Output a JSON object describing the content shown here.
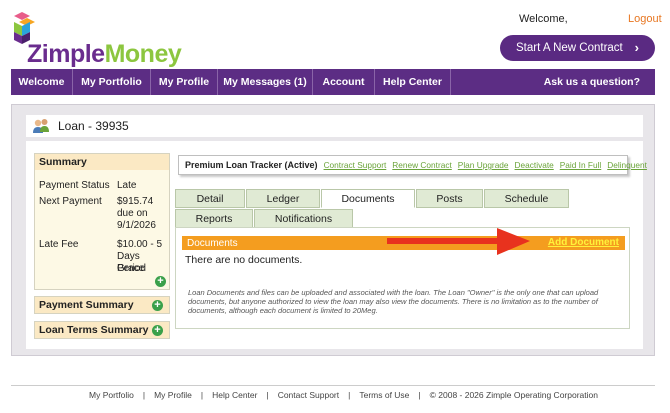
{
  "header": {
    "logo_z": "Zimple",
    "logo_m": "Money",
    "welcome": "Welcome,",
    "logout": "Logout",
    "start_contract": "Start A New Contract"
  },
  "nav": {
    "items": [
      "Welcome",
      "My Portfolio",
      "My Profile",
      "My Messages (1)",
      "Account",
      "Help Center"
    ],
    "ask": "Ask us a question?"
  },
  "loan": {
    "title": "Loan - 39935"
  },
  "summary": {
    "heading": "Summary",
    "payment_status_label": "Payment Status",
    "payment_status_value": "Late",
    "next_payment_label": "Next Payment",
    "next_payment_amount": "$915.74",
    "next_payment_due": "due on",
    "next_payment_date": "9/1/2026",
    "late_fee_label": "Late Fee",
    "late_fee_value": "$10.00 - 5",
    "late_fee_detail_1": "Days Grace",
    "late_fee_detail_2": "Period"
  },
  "accordions": {
    "payment_summary": "Payment Summary",
    "loan_terms": "Loan Terms Summary"
  },
  "tracker": {
    "name": "Premium Loan Tracker (Active)",
    "links": [
      "Contract Support",
      "Renew Contract",
      "Plan Upgrade",
      "Deactivate",
      "Paid In Full",
      "Delinquent"
    ]
  },
  "tabs": {
    "row1": [
      "Detail",
      "Ledger",
      "Documents",
      "Posts",
      "Schedule"
    ],
    "row2": [
      "Reports",
      "Notifications"
    ],
    "active": "Documents"
  },
  "documents": {
    "bar_title": "Documents",
    "add_label": "Add Document",
    "empty": "There are no documents.",
    "note": "Loan Documents and files can be uploaded and associated with the loan. The Loan \"Owner\" is the only one that can upload documents, but anyone authorized to view the loan may also view the documents. There is no limitation as to the number of documents, although each document is limited to 20Meg."
  },
  "footer": {
    "links": [
      "My Portfolio",
      "My Profile",
      "Help Center",
      "Contact Support",
      "Terms of Use"
    ],
    "copyright": "© 2008 - 2026 Zimple Operating Corporation"
  },
  "colors": {
    "brand_purple": "#5c2d84",
    "accent_orange": "#f49d1f",
    "link_green": "#6aa339",
    "arrow_red": "#e8321e"
  }
}
